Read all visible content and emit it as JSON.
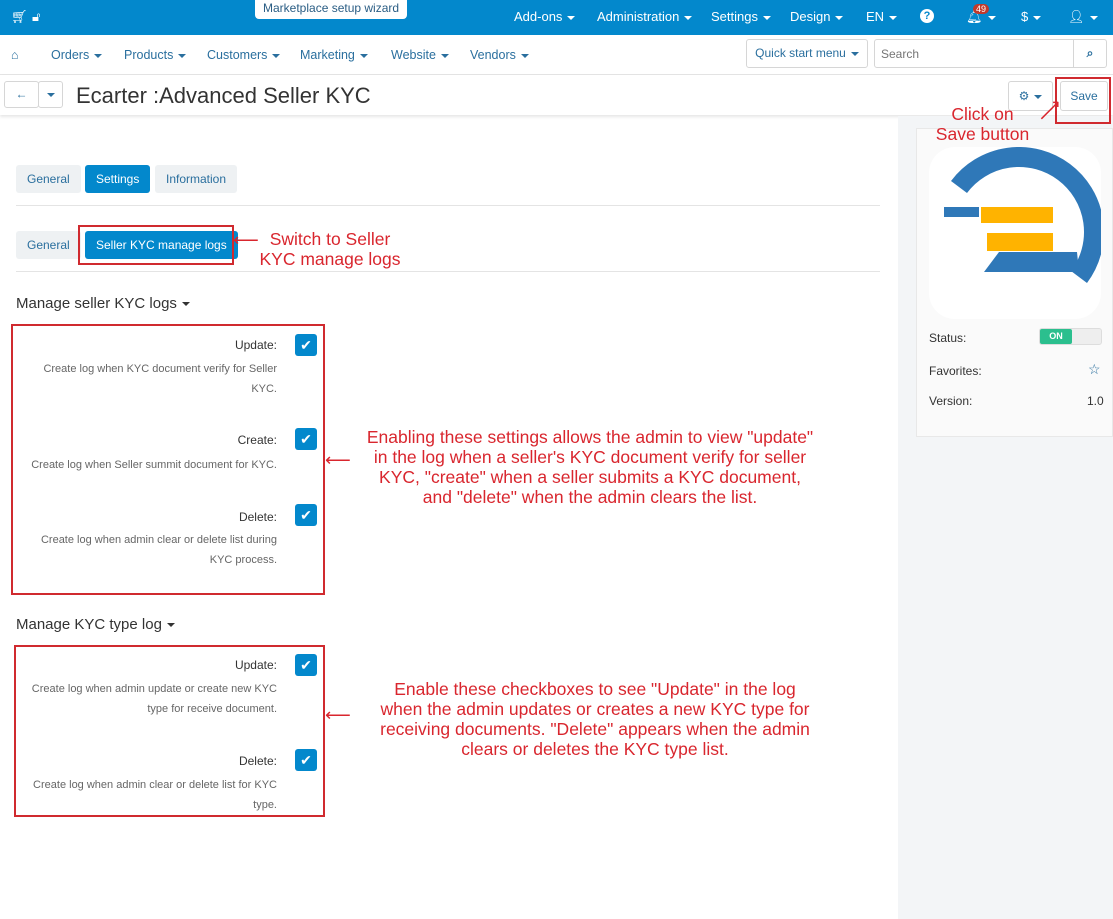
{
  "topbar": {
    "wizard": "Marketplace setup wizard",
    "items": [
      "Add-ons",
      "Administration",
      "Settings",
      "Design",
      "EN"
    ],
    "notification_count": "49",
    "currency": "$"
  },
  "nav": {
    "items": [
      "Orders",
      "Products",
      "Customers",
      "Marketing",
      "Website",
      "Vendors"
    ],
    "quick_start": "Quick start menu",
    "search_placeholder": "Search"
  },
  "page": {
    "title": "Ecarter :Advanced Seller KYC",
    "save": "Save"
  },
  "tabs": [
    "General",
    "Settings",
    "Information"
  ],
  "subtabs": [
    "General",
    "Seller KYC manage logs"
  ],
  "section1": {
    "title": "Manage seller KYC logs",
    "rows": [
      {
        "label": "Update:",
        "desc": [
          "Create log when KYC document verify for Seller",
          "KYC."
        ]
      },
      {
        "label": "Create:",
        "desc": [
          "Create log when Seller summit document for KYC."
        ]
      },
      {
        "label": "Delete:",
        "desc": [
          "Create log when admin clear or delete list during",
          "KYC process."
        ]
      }
    ]
  },
  "section2": {
    "title": "Manage KYC type log",
    "rows": [
      {
        "label": "Update:",
        "desc": [
          "Create log when admin update or create new KYC",
          "type for receive document."
        ]
      },
      {
        "label": "Delete:",
        "desc": [
          "Create log when admin clear or delete list for KYC",
          "type."
        ]
      }
    ]
  },
  "addon": {
    "status_label": "Status:",
    "status_value": "ON",
    "favorites_label": "Favorites:",
    "version_label": "Version:",
    "version": "1.0"
  },
  "annotations": {
    "save": [
      "Click on",
      "Save button"
    ],
    "switch": [
      "Switch to Seller",
      "KYC manage logs"
    ],
    "seller": [
      "Enabling these settings allows the admin to view \"update\"",
      "in the log when a seller's KYC document verify for seller",
      "KYC, \"create\" when a seller submits a KYC document,",
      "and \"delete\" when the admin clears the list."
    ],
    "type": [
      "Enable these checkboxes to see \"Update\" in the log",
      "when the admin updates or creates a new KYC type for",
      "receiving documents. \"Delete\" appears when the admin",
      "clears or deletes the KYC type list."
    ]
  },
  "colors": {
    "primary": "#0388cc",
    "annotation": "#d9262e",
    "status_on": "#2bbf8e"
  }
}
